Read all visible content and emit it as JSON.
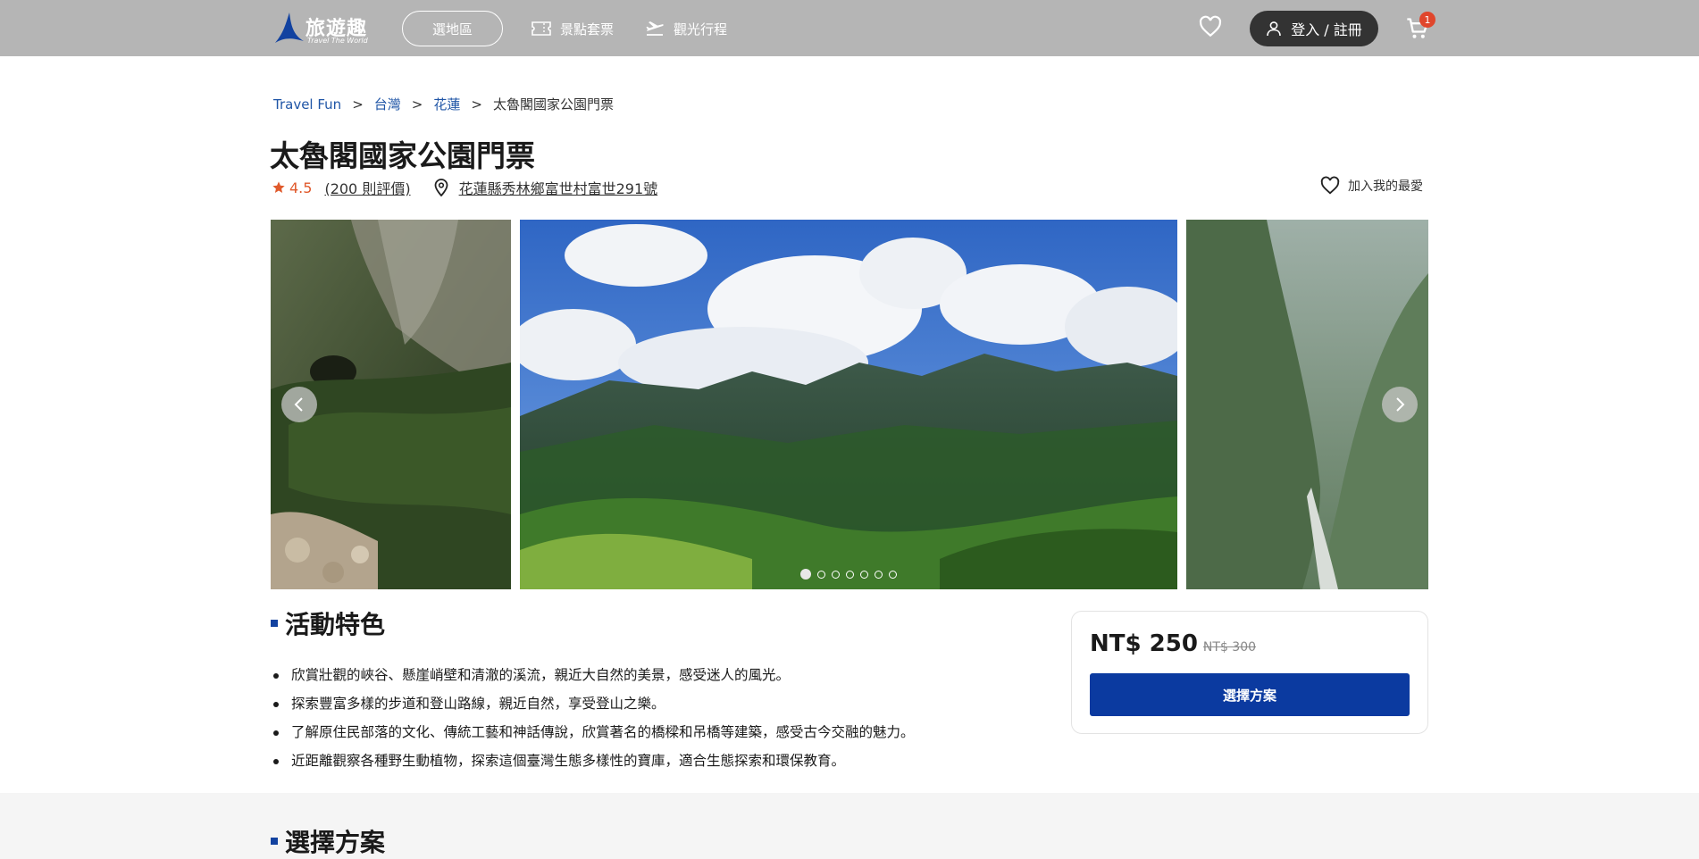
{
  "colors": {
    "header_bg": "#b5b5b5",
    "accent_blue": "#0b3aa0",
    "link_blue": "#1f55a6",
    "rating_orange": "#e05a2c",
    "badge_red": "#e0462c"
  },
  "header": {
    "logo_text": "旅遊趣",
    "logo_subtitle": "Travel The World",
    "region_button": "選地區",
    "nav": [
      {
        "icon": "ticket-icon",
        "label": "景點套票"
      },
      {
        "icon": "plane-icon",
        "label": "觀光行程"
      }
    ],
    "favorites_icon": "heart-icon",
    "login_label": "登入 / 註冊",
    "cart_icon": "cart-icon",
    "cart_count": "1"
  },
  "breadcrumb": {
    "items": [
      "Travel Fun",
      "台灣",
      "花蓮"
    ],
    "separator": ">",
    "current": "太魯閣國家公園門票"
  },
  "product": {
    "title": "太魯閣國家公園門票",
    "rating": "4.5",
    "reviews": "(200 則評價)",
    "address": "花蓮縣秀林鄉富世村富世291號",
    "favorite_label": "加入我的最愛"
  },
  "gallery": {
    "slide_count": 7,
    "active_slide": 1
  },
  "features": {
    "title": "活動特色",
    "items": [
      "欣賞壯觀的峽谷、懸崖峭壁和清澈的溪流，親近大自然的美景，感受迷人的風光。",
      "探索豐富多樣的步道和登山路線，親近自然，享受登山之樂。",
      "了解原住民部落的文化、傳統工藝和神話傳說，欣賞著名的橋樑和吊橋等建築，感受古今交融的魅力。",
      "近距離觀察各種野生動植物，探索這個臺灣生態多樣性的寶庫，適合生態探索和環保教育。"
    ]
  },
  "pricing": {
    "price": "NT$ 250",
    "original_price": "NT$ 300",
    "select_button": "選擇方案"
  },
  "plans": {
    "title": "選擇方案"
  }
}
